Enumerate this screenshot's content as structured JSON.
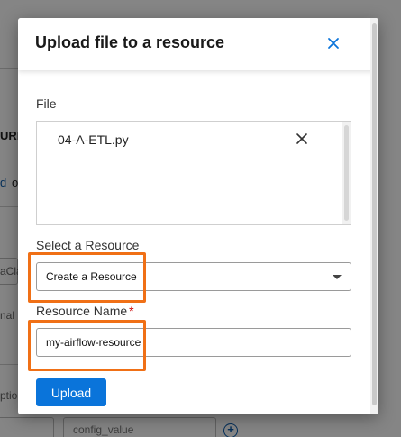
{
  "background": {
    "fragments": {
      "url_fragment": "URL",
      "link_fragment": "d",
      "link_suffix": "o",
      "field_fragment_1": "aCla",
      "field_fragment_2": "nal",
      "field_fragment_3": "ptio",
      "config_value_placeholder": "config_value"
    }
  },
  "modal": {
    "title": "Upload file to a resource",
    "close_icon": "close-icon",
    "file_section": {
      "label": "File",
      "files": [
        {
          "name": "04-A-ETL.py",
          "remove_icon": "close-icon"
        }
      ]
    },
    "select_resource": {
      "label": "Select a Resource",
      "selected": "Create a Resource",
      "caret_icon": "chevron-down-icon"
    },
    "resource_name": {
      "label": "Resource Name",
      "required_marker": "*",
      "value": "my-airflow-resource"
    },
    "upload_button": {
      "label": "Upload"
    },
    "highlight_color": "#f07016",
    "accent_color": "#0a74da"
  }
}
